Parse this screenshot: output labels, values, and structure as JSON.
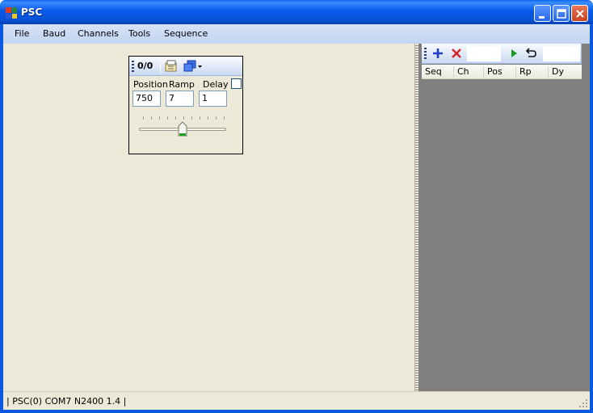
{
  "window": {
    "title": "PSC"
  },
  "menu": [
    "File",
    "Baud",
    "Channels",
    "Tools",
    "Sequence"
  ],
  "servo": {
    "counter": "0/0",
    "labels": {
      "position": "Position",
      "ramp": "Ramp",
      "delay": "Delay"
    },
    "values": {
      "position": "750",
      "ramp": "7",
      "delay": "1"
    },
    "slider_fraction": 0.5
  },
  "sequence": {
    "columns": [
      "Seq",
      "Ch",
      "Pos",
      "Rp",
      "Dy"
    ]
  },
  "status": {
    "text": "| PSC(0) COM7 N2400 1.4 |"
  },
  "colors": {
    "titlebar": "#0858ea",
    "client": "#ece9d8",
    "seq_area": "#808080"
  }
}
